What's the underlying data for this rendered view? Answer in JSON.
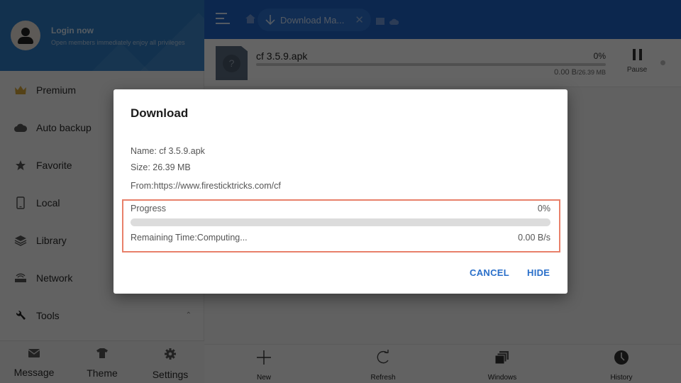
{
  "sidebar": {
    "login_title": "Login now",
    "login_subtitle": "Open members immediately enjoy all privileges",
    "items": [
      {
        "label": "Premium",
        "icon": "crown-icon"
      },
      {
        "label": "Auto backup",
        "icon": "cloud-backup-icon"
      },
      {
        "label": "Favorite",
        "icon": "star-icon"
      },
      {
        "label": "Local",
        "icon": "phone-icon"
      },
      {
        "label": "Library",
        "icon": "layers-icon"
      },
      {
        "label": "Network",
        "icon": "router-icon"
      },
      {
        "label": "Tools",
        "icon": "wrench-icon",
        "expanded": true
      }
    ],
    "bottom": [
      {
        "label": "Message",
        "icon": "envelope-icon"
      },
      {
        "label": "Theme",
        "icon": "tshirt-icon"
      },
      {
        "label": "Settings",
        "icon": "gear-icon"
      }
    ]
  },
  "header": {
    "tab_label": "Download Ma...",
    "accent_color": "#1e63c4"
  },
  "download_item": {
    "file_name": "cf 3.5.9.apk",
    "percent_text": "0%",
    "progress_fraction": 0,
    "downloaded": "0.00 B",
    "total": "/26.39 MB",
    "pause_label": "Pause"
  },
  "bottom_nav": [
    {
      "label": "New",
      "icon": "plus-icon"
    },
    {
      "label": "Refresh",
      "icon": "refresh-icon"
    },
    {
      "label": "Windows",
      "icon": "windows-icon"
    },
    {
      "label": "History",
      "icon": "clock-icon"
    }
  ],
  "dialog": {
    "title": "Download",
    "name_line": "Name: cf 3.5.9.apk",
    "size_line": "Size: 26.39 MB",
    "from_line": "From:https://www.firesticktricks.com/cf",
    "progress_label": "Progress",
    "progress_percent_text": "0%",
    "progress_fraction": 0,
    "remaining_time": "Remaining Time:Computing...",
    "speed": "0.00 B/s",
    "cancel_label": "CANCEL",
    "hide_label": "HIDE",
    "highlight_color": "#e8806a",
    "button_color": "#2a6fc9"
  }
}
